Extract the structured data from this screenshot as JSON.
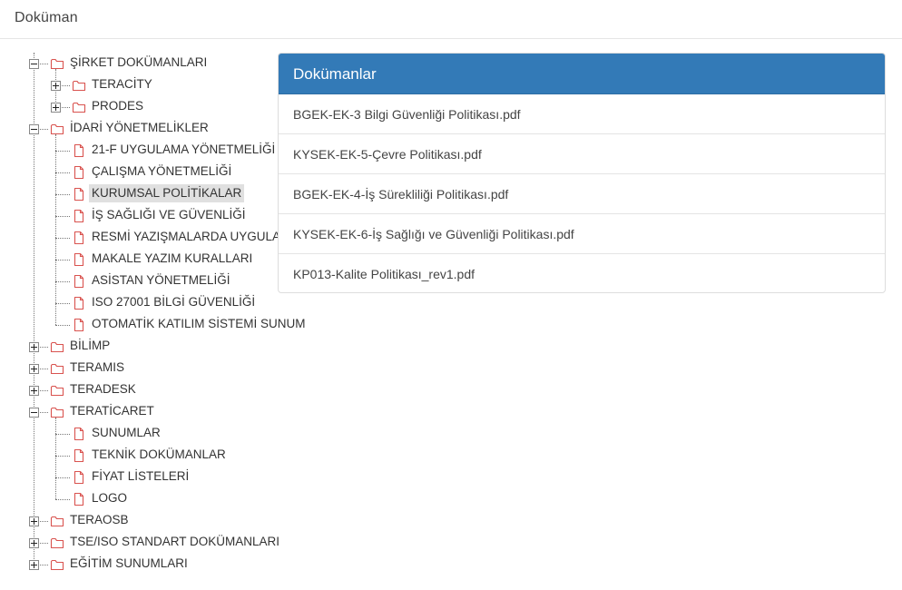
{
  "page": {
    "title": "Doküman"
  },
  "panel": {
    "title": "Dokümanlar",
    "documents": [
      "BGEK-EK-3 Bilgi Güvenliği Politikası.pdf",
      "KYSEK-EK-5-Çevre Politikası.pdf",
      "BGEK-EK-4-İş Sürekliliği Politikası.pdf",
      "KYSEK-EK-6-İş Sağlığı ve Güvenliği Politikası.pdf",
      "KP013-Kalite Politikası_rev1.pdf"
    ]
  },
  "tree": {
    "nodes": [
      "ŞİRKET DOKÜMANLARI",
      "TERACİTY",
      "PRODES",
      "İDARİ YÖNETMELİKLER",
      "21-F UYGULAMA YÖNETMELİĞİ",
      "ÇALIŞMA YÖNETMELİĞİ",
      "KURUMSAL POLİTİKALAR",
      "İŞ SAĞLIĞI VE GÜVENLİĞİ",
      "RESMİ YAZIŞMALARDA UYGULA",
      "MAKALE YAZIM KURALLARI",
      "ASİSTAN YÖNETMELİĞİ",
      "ISO 27001 BİLGİ GÜVENLİĞİ",
      "OTOMATİK KATILIM SİSTEMİ SUNUM",
      "BİLİMP",
      "TERAMIS",
      "TERADESK",
      "TERATİCARET",
      "SUNUMLAR",
      "TEKNİK DOKÜMANLAR",
      "FİYAT LİSTELERİ",
      "LOGO",
      "TERAOSB",
      "TSE/ISO STANDART DOKÜMANLARI",
      "EĞİTİM SUNUMLARI"
    ],
    "selected_node": "KURUMSAL POLİTİKALAR"
  },
  "colors": {
    "panel_header": "#337ab7",
    "icon_red": "#d9534f",
    "selected_bg": "#e0e0e0"
  }
}
